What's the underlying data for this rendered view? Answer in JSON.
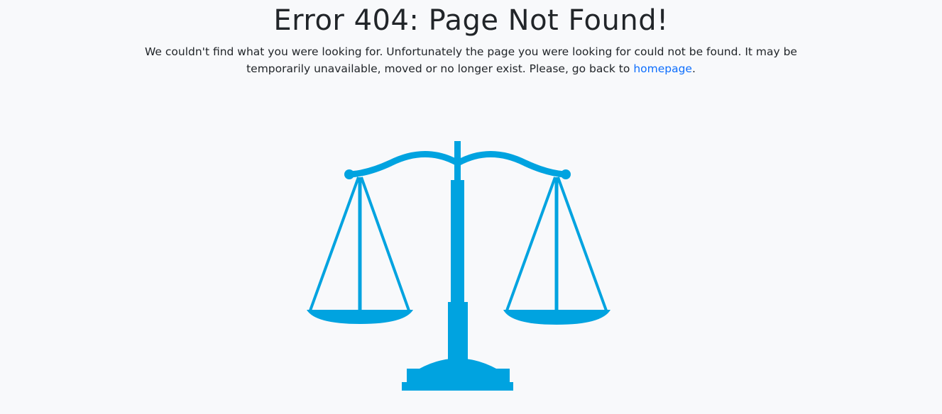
{
  "error": {
    "title": "Error 404: Page Not Found!",
    "message_part1": "We couldn't find what you were looking for. Unfortunately the page you were looking for could not be found. It may be temporarily unavailable, moved or no longer exist. Please, go back to",
    "homepage_link": "homepage",
    "message_end": "."
  },
  "illustration": {
    "icon": "scales-of-justice-icon",
    "color": "#00a3e0"
  },
  "colors": {
    "background": "#f8f9fb",
    "text": "#212529",
    "link": "#0d6efd"
  }
}
